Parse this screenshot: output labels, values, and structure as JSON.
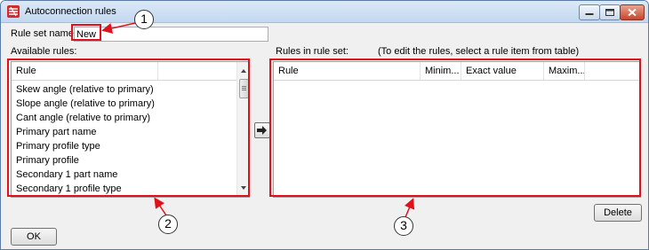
{
  "window": {
    "title": "Autoconnection rules"
  },
  "rule_set": {
    "label": "Rule set name:",
    "value": "New"
  },
  "available": {
    "label": "Available rules:",
    "header": "Rule",
    "items": [
      "Skew angle (relative to primary)",
      "Slope angle (relative to primary)",
      "Cant angle (relative to primary)",
      "Primary part name",
      "Primary profile type",
      "Primary profile",
      "Secondary 1 part name",
      "Secondary 1 profile type"
    ]
  },
  "rules_in_set": {
    "label": "Rules in rule set:",
    "hint": "(To edit the rules, select a rule item from table)",
    "columns": [
      "Rule",
      "Minim...",
      "Exact value",
      "Maxim..."
    ]
  },
  "buttons": {
    "delete": "Delete",
    "ok": "OK"
  },
  "callouts": [
    "1",
    "2",
    "3"
  ],
  "colors": {
    "highlight": "#e0111b",
    "titlebar": "#c3d8f0"
  },
  "icons": {
    "app": "tekla-app-icon",
    "add": "right-arrow-icon"
  }
}
